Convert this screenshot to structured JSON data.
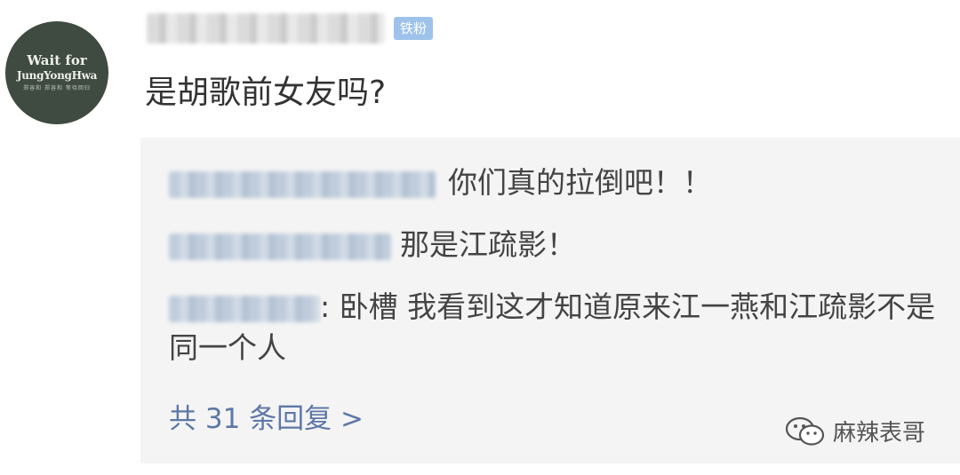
{
  "post": {
    "avatar_lines": [
      "Wait for",
      "JungYongHwa",
      "郑容和 郑容和 等待回归"
    ],
    "username_hidden": true,
    "badge": "铁粉",
    "comment": "是胡歌前女友吗?"
  },
  "replies": [
    {
      "text": "你们真的拉倒吧！！"
    },
    {
      "text": "那是江疏影！"
    },
    {
      "text": ": 卧槽 我看到这才知道原来江一燕和江疏影不是同一个人"
    }
  ],
  "more_replies": "共 31 条回复 >",
  "watermark": {
    "icon": "wechat-icon",
    "text": "麻辣表哥"
  },
  "colors": {
    "badge": "#9ec2ea",
    "link": "#5d78a6",
    "reply_bg": "#f4f4f4",
    "avatar_bg": "#3f4a40"
  }
}
